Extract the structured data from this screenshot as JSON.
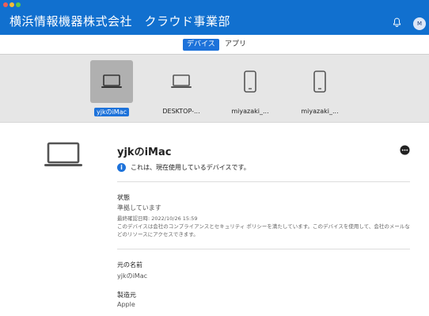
{
  "window": {
    "title": "横浜情報機器株式会社　クラウド事業部",
    "avatar_initial": "M"
  },
  "tabs": [
    {
      "label": "デバイス",
      "active": true
    },
    {
      "label": "アプリ",
      "active": false
    }
  ],
  "devices": [
    {
      "label": "yjkのiMac",
      "icon": "laptop-icon",
      "selected": true
    },
    {
      "label": "DESKTOP-...",
      "icon": "laptop-icon",
      "selected": false
    },
    {
      "label": "miyazaki_...",
      "icon": "phone-icon",
      "selected": false
    },
    {
      "label": "miyazaki_...",
      "icon": "phone-icon",
      "selected": false
    }
  ],
  "detail": {
    "name": "yjkのiMac",
    "current_notice": "これは、現在使用しているデバイスです。",
    "status_heading": "状態",
    "status_value": "準拠しています",
    "last_checked": "最終確認日時: 2022/10/26 15:59",
    "compliance_note": "このデバイスは会社のコンプライアンスとセキュリティ ポリシーを満たしています。このデバイスを使用して、会社のメールなどのリソースにアクセスできます。",
    "original_name_heading": "元の名前",
    "original_name_value": "yjkのiMac",
    "manufacturer_heading": "製造元",
    "manufacturer_value": "Apple"
  },
  "colors": {
    "accent": "#1d72da",
    "titlebar": "#1170cf"
  }
}
